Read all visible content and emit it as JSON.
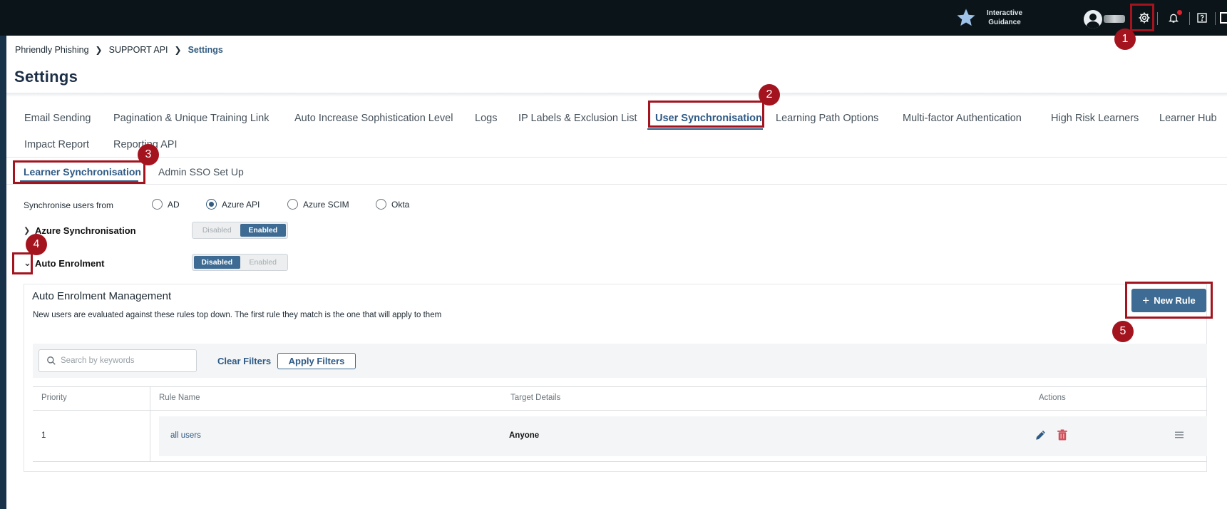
{
  "topbar": {
    "guidance_line1": "Interactive",
    "guidance_line2": "Guidance",
    "icons": [
      "star-icon",
      "user-avatar-icon",
      "gear-icon",
      "bell-icon",
      "help-icon",
      "panel-icon"
    ]
  },
  "annotations": [
    "1",
    "2",
    "3",
    "4",
    "5"
  ],
  "breadcrumb": {
    "items": [
      "Phriendly Phishing",
      "SUPPORT API",
      "Settings"
    ]
  },
  "page_title": "Settings",
  "tabs": [
    "Email Sending",
    "Pagination & Unique Training Link",
    "Auto Increase Sophistication Level",
    "Logs",
    "IP Labels & Exclusion List",
    "User Synchronisation",
    "Learning Path Options",
    "Multi-factor Authentication",
    "High Risk Learners",
    "Learner Hub",
    "Impact Report",
    "Reporting API"
  ],
  "active_tab": "User Synchronisation",
  "subtabs": [
    "Learner Synchronisation",
    "Admin SSO Set Up"
  ],
  "active_subtab": "Learner Synchronisation",
  "sync": {
    "label": "Synchronise users from",
    "options": [
      "AD",
      "Azure API",
      "Azure SCIM",
      "Okta"
    ],
    "selected": "Azure API"
  },
  "sections": {
    "azure": {
      "label": "Azure Synchronisation",
      "disabled": "Disabled",
      "enabled": "Enabled",
      "state": "Enabled"
    },
    "auto": {
      "label": "Auto Enrolment",
      "disabled": "Disabled",
      "enabled": "Enabled",
      "state": "Disabled"
    }
  },
  "panel": {
    "title": "Auto Enrolment Management",
    "description": "New users are evaluated against these rules top down. The first rule they match is the one that will apply to them",
    "new_rule": "New Rule",
    "search_placeholder": "Search by keywords",
    "clear_filters": "Clear Filters",
    "apply_filters": "Apply Filters"
  },
  "table": {
    "headers": [
      "Priority",
      "Rule Name",
      "Target Details",
      "Actions"
    ],
    "rows": [
      {
        "priority": "1",
        "rule_name": "all users",
        "target": "Anyone"
      }
    ]
  },
  "colors": {
    "topbar": "#0b1519",
    "accent": "#2e5a86",
    "button": "#3e6b93",
    "annotation": "#a3141f",
    "delete": "#d0505a"
  }
}
